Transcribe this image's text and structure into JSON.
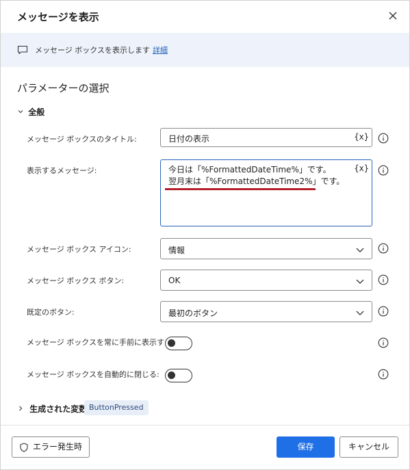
{
  "dialog": {
    "title": "メッセージを表示",
    "info_text": "メッセージ ボックスを表示します",
    "info_link": "詳細"
  },
  "section": {
    "title": "パラメーターの選択",
    "group_label": "全般"
  },
  "fields": {
    "title_label": "メッセージ ボックスのタイトル:",
    "title_value": "日付の表示",
    "message_label": "表示するメッセージ:",
    "message_line1": "今日は「%FormattedDateTime%」です。",
    "message_line2": "翌月末は「%FormattedDateTime2%」です。",
    "var_button": "{x}",
    "icon_label": "メッセージ ボックス アイコン:",
    "icon_value": "情報",
    "button_label": "メッセージ ボックス ボタン:",
    "button_value": "OK",
    "default_label": "既定のボタン:",
    "default_value": "最初のボタン",
    "topmost_label": "メッセージ ボックスを常に手前に表示する:",
    "autoclose_label": "メッセージ ボックスを自動的に閉じる:"
  },
  "toggles": {
    "topmost": false,
    "autoclose": false
  },
  "variables": {
    "label": "生成された変数",
    "chip": "ButtonPressed"
  },
  "footer": {
    "error_button": "エラー発生時",
    "save_button": "保存",
    "cancel_button": "キャンセル"
  },
  "colors": {
    "accent": "#1f6fe6",
    "link": "#2563b8",
    "underline_annotation": "#b51f2a",
    "info_bar": "#eef3fb"
  },
  "icons": [
    "close-icon",
    "message-icon",
    "chevron-down-icon",
    "chevron-right-icon",
    "help-icon",
    "shield-icon"
  ]
}
